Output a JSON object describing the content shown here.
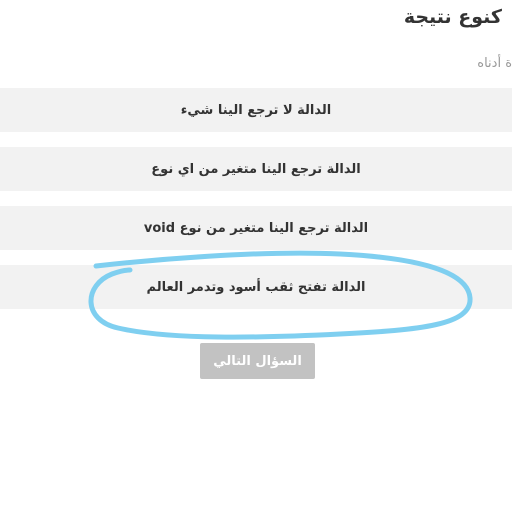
{
  "question": {
    "title": "كنوع نتيجة",
    "subtitle": "ة أدناه"
  },
  "options": [
    {
      "label": "الدالة لا ترجع الينا شيء"
    },
    {
      "label": "الدالة ترجع الينا متغير من اي نوع"
    },
    {
      "label": "الدالة ترجع الينا متغير من نوع void"
    },
    {
      "label": "الدالة تفتح ثقب أسود وتدمر العالم"
    }
  ],
  "next_button": {
    "label": "السؤال التالي"
  },
  "colors": {
    "option_bg": "#f2f2f2",
    "button_disabled": "#c2c2c2",
    "annotation_stroke": "#7fcff0"
  }
}
